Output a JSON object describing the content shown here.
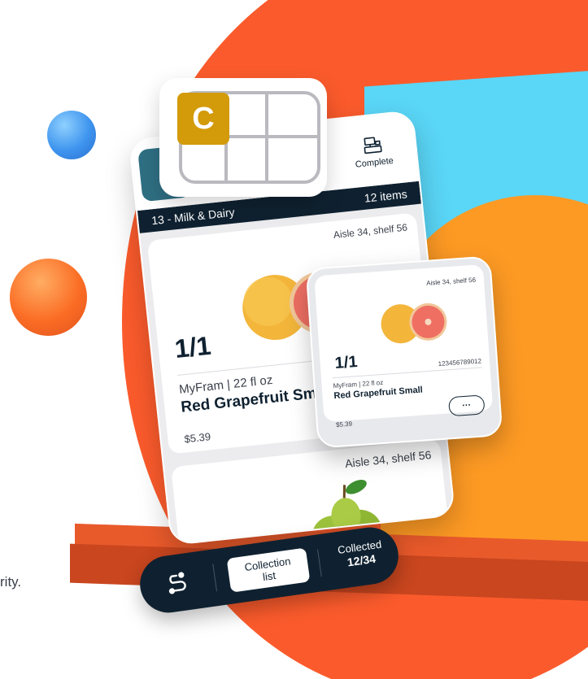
{
  "left_text": {
    "tail": "rity."
  },
  "grid_card": {
    "badge_letter": "C"
  },
  "phone": {
    "complete_label": "Complete",
    "section": {
      "title": "13 - Milk & Dairy",
      "count": "12 items"
    },
    "product": {
      "aisle": "Aisle 34, shelf 56",
      "quantity": "1/1",
      "brand_size": "MyFram |  22 fl oz",
      "name": "Red Grapefruit Sma",
      "price": "$5.39"
    },
    "next_product": {
      "aisle": "Aisle 34, shelf 56"
    }
  },
  "mini_card": {
    "aisle": "Aisle 34, shelf 56",
    "quantity": "1/1",
    "barcode": "123456789012",
    "brand_size": "MyFram |  22 fl oz",
    "name": "Red Grapefruit Small",
    "more": "···",
    "price": "$5.39"
  },
  "bottom_nav": {
    "collection_line1": "Collection",
    "collection_line2": "list",
    "collected_label": "Collected",
    "collected_value": "12/34"
  },
  "colors": {
    "orange_bg": "#fb5b2c",
    "cyan_block": "#5ad6f7",
    "yellow_arch": "#fd9a24",
    "navy": "#0f2130",
    "badge_gold": "#d39a0a"
  }
}
